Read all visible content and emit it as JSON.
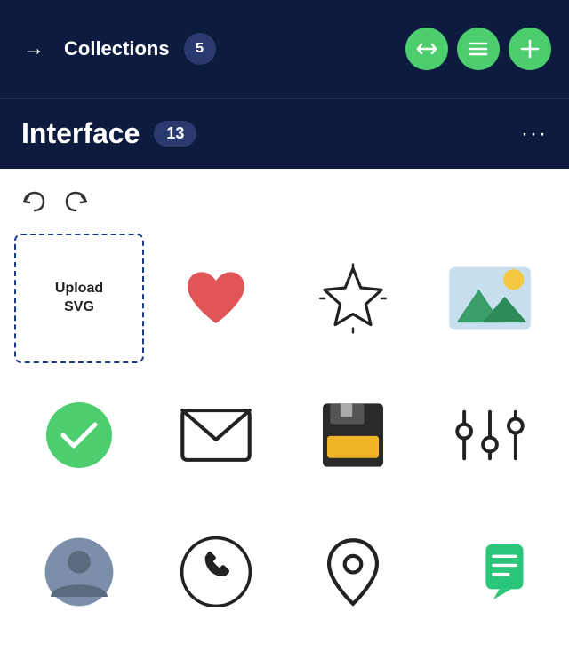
{
  "header": {
    "back_arrow": "→",
    "title": "Collections",
    "count": "5",
    "actions": [
      {
        "label": "resize-icon",
        "icon": "↔"
      },
      {
        "label": "list-icon",
        "icon": "≡"
      },
      {
        "label": "add-icon",
        "icon": "+"
      }
    ]
  },
  "sub_header": {
    "title": "Interface",
    "count": "13",
    "more_label": "···"
  },
  "toolbar": {
    "undo_label": "undo",
    "redo_label": "redo"
  },
  "upload_cell": {
    "line1": "Upload",
    "line2": "SVG"
  },
  "colors": {
    "header_bg": "#0d1b3e",
    "accent_green": "#4cce6e",
    "heart_red": "#e05555",
    "floppy_yellow": "#f0b429",
    "image_bg": "#c8dff0",
    "image_mountain": "#3a9e6a",
    "image_sun_yellow": "#f5c842",
    "chat_green": "#2ac679"
  }
}
